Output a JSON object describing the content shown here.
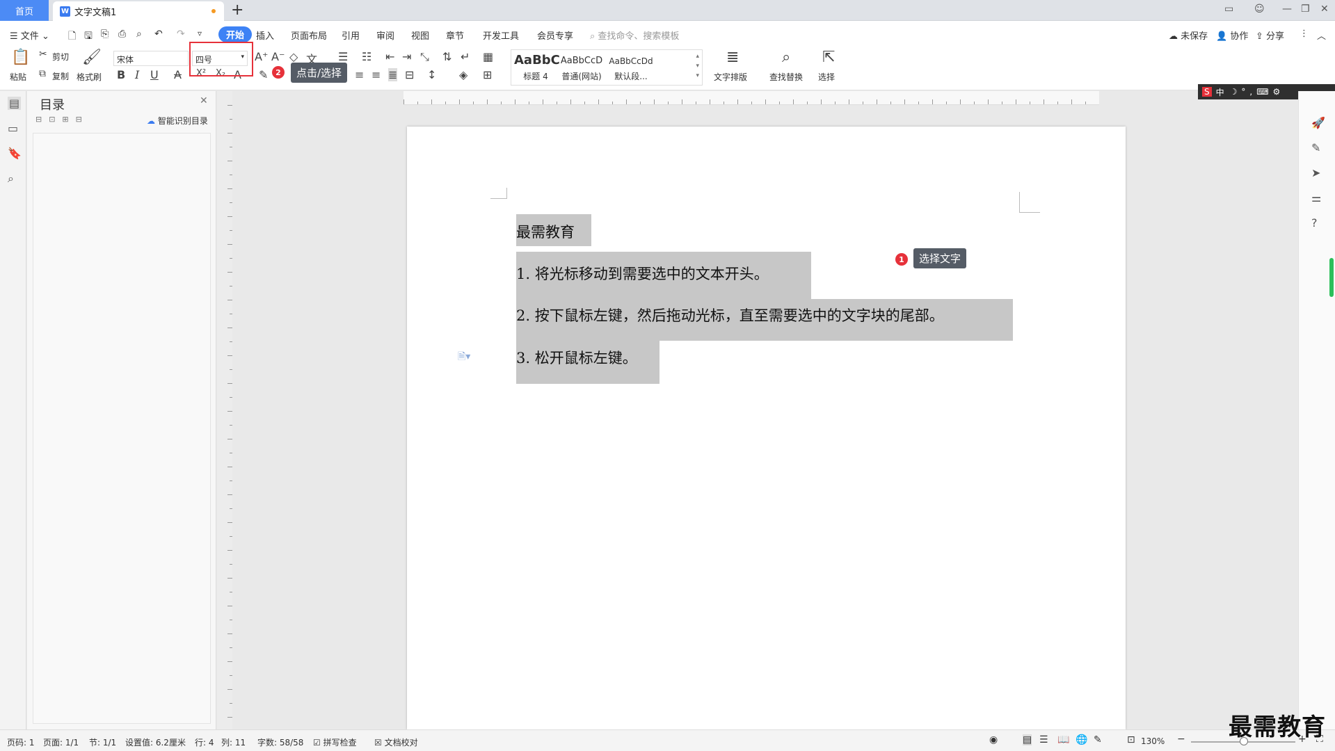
{
  "tabs": {
    "home": "首页",
    "doc": "文字文稿1"
  },
  "menu": {
    "file": "文件",
    "items": [
      "开始",
      "插入",
      "页面布局",
      "引用",
      "审阅",
      "视图",
      "章节",
      "开发工具",
      "会员专享"
    ],
    "search_placeholder": "查找命令、搜索模板",
    "right": {
      "unsaved": "未保存",
      "collab": "协作",
      "share": "分享"
    }
  },
  "ribbon": {
    "paste": "粘贴",
    "cut": "剪切",
    "copy": "复制",
    "format_painter": "格式刷",
    "font_name": "宋体",
    "font_size": "四号",
    "styles": [
      {
        "preview": "AaBbC",
        "label": "标题 4"
      },
      {
        "preview": "AaBbCcD",
        "label": "普通(网站)"
      },
      {
        "preview": "AaBbCcDd",
        "label": "默认段..."
      }
    ],
    "text_layout": "文字排版",
    "find_replace": "查找替换",
    "select": "选择"
  },
  "tooltips": {
    "step1_badge": "1",
    "step1": "选择文字",
    "step2_badge": "2",
    "step2": "点击/选择"
  },
  "toc": {
    "title": "目录",
    "smart": "智能识别目录"
  },
  "document": {
    "lines": [
      "最需教育",
      "1. 将光标移动到需要选中的文本开头。",
      "2. 按下鼠标左键，然后拖动光标，直至需要选中的文字块的尾部。",
      "3. 松开鼠标左键。"
    ]
  },
  "status": {
    "page_code": "页码: 1",
    "pages": "页面: 1/1",
    "section": "节: 1/1",
    "setting": "设置值: 6.2厘米",
    "row": "行: 4",
    "col": "列: 11",
    "words": "字数: 58/58",
    "spell": "拼写检查",
    "proof": "文档校对",
    "zoom": "130%"
  },
  "watermark": "最需教育",
  "ime": "中"
}
